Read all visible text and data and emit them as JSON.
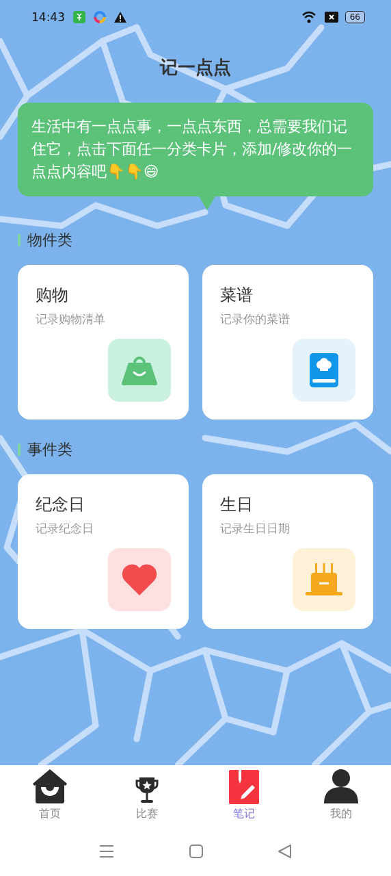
{
  "status_bar": {
    "time": "14:43",
    "battery": "66"
  },
  "title": "记一点点",
  "tip": "生活中有一点点事，一点点东西，总需要我们记住它，点击下面任一分类卡片，添加/修改你的一点点内容吧👇👇😄",
  "sections": [
    {
      "title": "物件类",
      "cards": [
        {
          "title": "购物",
          "subtitle": "记录购物清单",
          "kind": "bag",
          "color": "#c9f1dd"
        },
        {
          "title": "菜谱",
          "subtitle": "记录你的菜谱",
          "kind": "book",
          "color": "#e4f2fc"
        }
      ]
    },
    {
      "title": "事件类",
      "cards": [
        {
          "title": "纪念日",
          "subtitle": "记录纪念日",
          "kind": "heart",
          "color": "#ffe0e0"
        },
        {
          "title": "生日",
          "subtitle": "记录生日日期",
          "kind": "cake",
          "color": "#fff1d8"
        }
      ]
    }
  ],
  "tabs": [
    {
      "label": "首页",
      "kind": "home",
      "selected": false
    },
    {
      "label": "比赛",
      "kind": "trophy",
      "selected": false
    },
    {
      "label": "笔记",
      "kind": "note",
      "selected": true
    },
    {
      "label": "我的",
      "kind": "person",
      "selected": false
    }
  ]
}
